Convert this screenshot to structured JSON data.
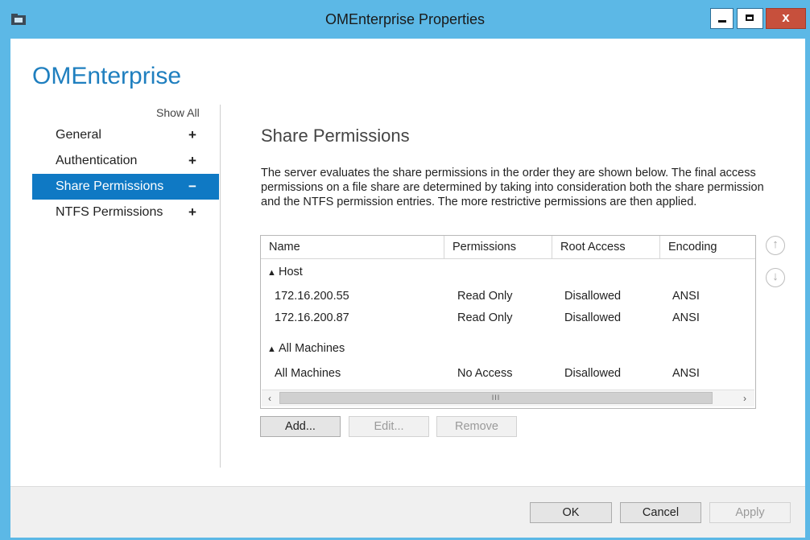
{
  "window": {
    "title": "OMEnterprise Properties",
    "close_glyph": "x"
  },
  "app_heading": "OMEnterprise",
  "nav": {
    "show_all": "Show All",
    "items": [
      {
        "label": "General",
        "sign": "+"
      },
      {
        "label": "Authentication",
        "sign": "+"
      },
      {
        "label": "Share Permissions",
        "sign": "−",
        "selected": true
      },
      {
        "label": "NTFS Permissions",
        "sign": "+"
      }
    ]
  },
  "section": {
    "title": "Share Permissions",
    "description": "The server evaluates the share permissions in the order they are shown below. The final access permissions on a file share are determined by taking into consideration both the share permission and the NTFS permission entries. The more restrictive permissions are then applied."
  },
  "table": {
    "columns": [
      "Name",
      "Permissions",
      "Root Access",
      "Encoding"
    ],
    "groups": [
      {
        "label": "Host",
        "rows": [
          {
            "name": "172.16.200.55",
            "permissions": "Read Only",
            "root_access": "Disallowed",
            "encoding": "ANSI"
          },
          {
            "name": "172.16.200.87",
            "permissions": "Read Only",
            "root_access": "Disallowed",
            "encoding": "ANSI"
          }
        ]
      },
      {
        "label": "All Machines",
        "rows": [
          {
            "name": "All Machines",
            "permissions": "No Access",
            "root_access": "Disallowed",
            "encoding": "ANSI"
          }
        ]
      }
    ],
    "scroll_thumb_label": "III"
  },
  "actions": {
    "add": "Add...",
    "edit": "Edit...",
    "remove": "Remove"
  },
  "footer": {
    "ok": "OK",
    "cancel": "Cancel",
    "apply": "Apply"
  },
  "colors": {
    "titlebar": "#5cb8e6",
    "selection": "#0f79c4",
    "heading": "#1f7fbf",
    "close_button": "#c7503c"
  },
  "icons": {
    "app": "folder-properties-icon",
    "up": "move-up-icon",
    "down": "move-down-icon"
  }
}
